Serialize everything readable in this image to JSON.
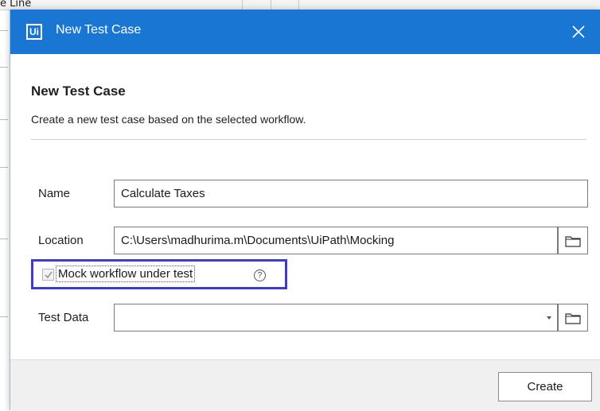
{
  "background": {
    "fragment_text": "e Line"
  },
  "dialog": {
    "window_title": "New Test Case",
    "logo_text": "Ui",
    "heading": "New Test Case",
    "subtitle": "Create a new test case based on the selected workflow.",
    "fields": {
      "name": {
        "label": "Name",
        "value": "Calculate Taxes"
      },
      "location": {
        "label": "Location",
        "value": "C:\\Users\\madhurima.m\\Documents\\UiPath\\Mocking"
      },
      "mock": {
        "label": "Mock workflow under test",
        "checked": true,
        "help_glyph": "?"
      },
      "test_data": {
        "label": "Test Data",
        "value": ""
      }
    },
    "footer": {
      "create_label": "Create"
    },
    "colors": {
      "titlebar": "#1976d2",
      "highlight": "#3b3bd6"
    }
  }
}
